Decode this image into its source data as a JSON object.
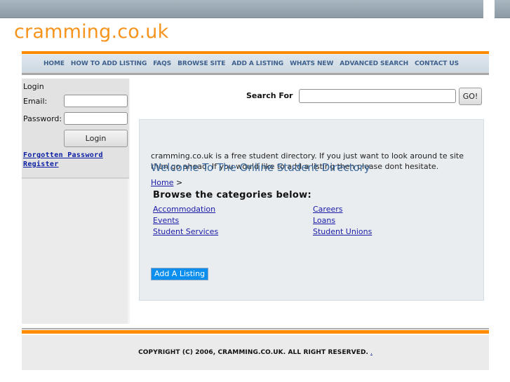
{
  "site": {
    "logo": "cramming.co.uk"
  },
  "nav": {
    "items": [
      {
        "label": "HOME"
      },
      {
        "label": "HOW TO ADD LISTING"
      },
      {
        "label": "FAQS"
      },
      {
        "label": "BROWSE SITE"
      },
      {
        "label": "ADD A LISTING"
      },
      {
        "label": "WHATS NEW"
      },
      {
        "label": "ADVANCED SEARCH"
      },
      {
        "label": "CONTACT US"
      }
    ],
    "accent_color": "#ff8c00"
  },
  "login": {
    "title": "Login",
    "email_label": "Email:",
    "email_value": "",
    "password_label": "Password:",
    "password_value": "",
    "button_label": "Login",
    "forgot_link": "Forgotten Password",
    "register_link": "Register"
  },
  "search": {
    "label": "Search For",
    "value": "",
    "button_label": "GO!"
  },
  "main": {
    "intro": "cramming.co.uk is a free student directory. If you just want to look around te site then go ahead. If you would like to add a listing then please dont hesitate.",
    "welcome": "Welcome To The Online Student Directory",
    "breadcrumb_home": "Home",
    "breadcrumb_sep": ">",
    "browse_title": "Browse the categories below:",
    "categories": [
      {
        "label": "Accommodation"
      },
      {
        "label": "Careers"
      },
      {
        "label": "Events"
      },
      {
        "label": "Loans"
      },
      {
        "label": "Student Services"
      },
      {
        "label": "Student Unions"
      }
    ],
    "add_listing_button": "Add A Listing"
  },
  "footer": {
    "copyright": "COPYRIGHT (C) 2006, CRAMMING.CO.UK. ALL RIGHT RESERVED.",
    "link": "."
  }
}
